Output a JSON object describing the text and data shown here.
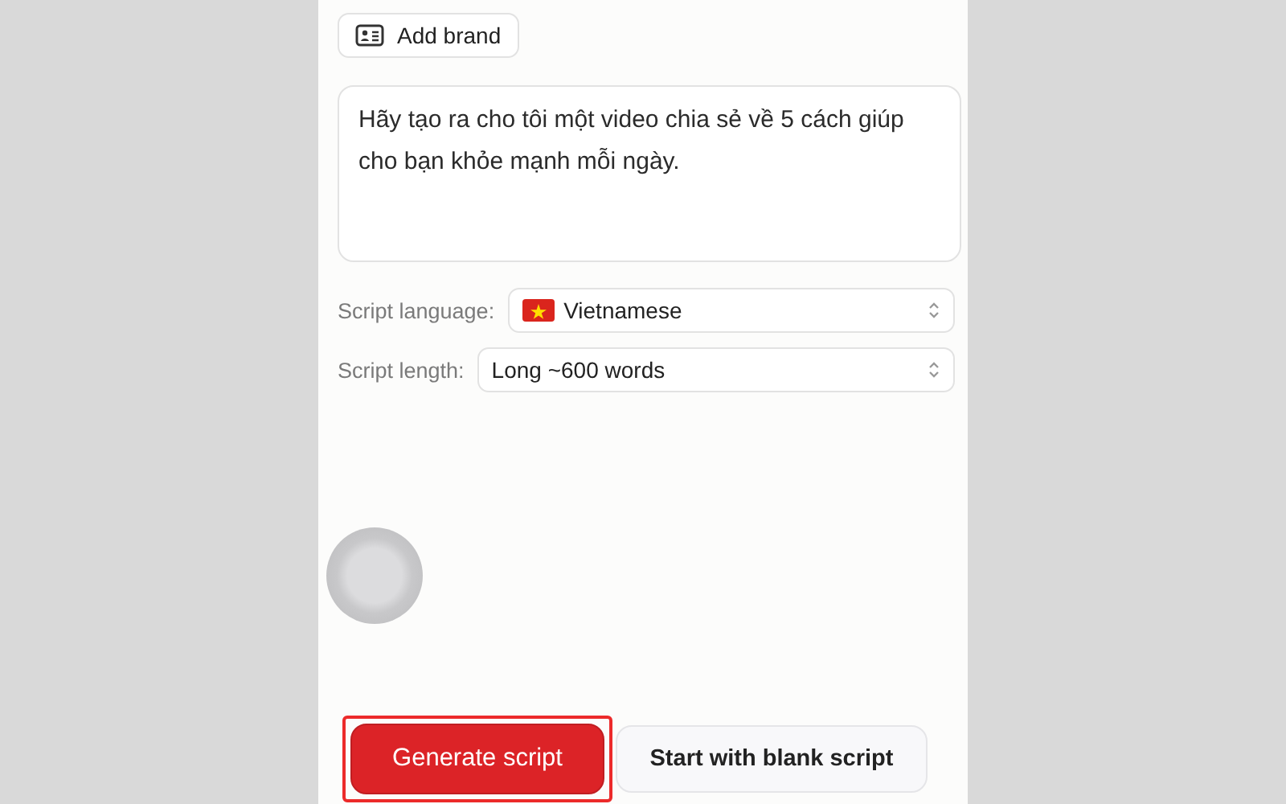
{
  "add_brand_button": {
    "label": "Add brand"
  },
  "prompt": {
    "value": "Hãy tạo ra cho tôi một video chia sẻ về 5 cách giúp cho bạn khỏe mạnh mỗi ngày."
  },
  "settings": [
    {
      "label": "Script language:",
      "value": "Vietnamese",
      "kind": "flag"
    },
    {
      "label": "Script length:",
      "value": "Long ~600 words",
      "kind": "plain"
    }
  ],
  "buttons": [
    {
      "label": "Generate script",
      "kind": "primary",
      "highlighted": true
    },
    {
      "label": "Start with blank script",
      "kind": "secondary",
      "highlighted": false
    }
  ]
}
